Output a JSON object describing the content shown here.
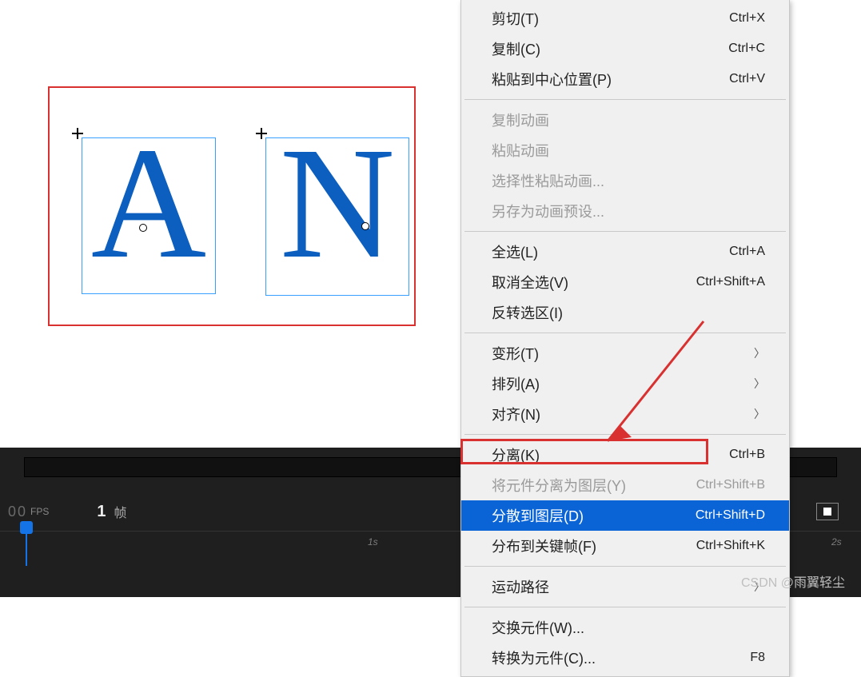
{
  "stage": {
    "letterA": "A",
    "letterN": "N"
  },
  "timeline": {
    "fps_value": "00",
    "fps_label": "FPS",
    "frame_number": "1",
    "frame_label": "帧",
    "tick_1s": "1s",
    "tick_2s": "2s"
  },
  "menu": {
    "cut": {
      "label": "剪切(T)",
      "shortcut": "Ctrl+X"
    },
    "copy": {
      "label": "复制(C)",
      "shortcut": "Ctrl+C"
    },
    "paste_center": {
      "label": "粘贴到中心位置(P)",
      "shortcut": "Ctrl+V"
    },
    "copy_motion": {
      "label": "复制动画"
    },
    "paste_motion": {
      "label": "粘贴动画"
    },
    "paste_motion_sp": {
      "label": "选择性粘贴动画..."
    },
    "save_preset": {
      "label": "另存为动画预设..."
    },
    "select_all": {
      "label": "全选(L)",
      "shortcut": "Ctrl+A"
    },
    "deselect": {
      "label": "取消全选(V)",
      "shortcut": "Ctrl+Shift+A"
    },
    "invert_sel": {
      "label": "反转选区(I)"
    },
    "transform": {
      "label": "变形(T)"
    },
    "arrange": {
      "label": "排列(A)"
    },
    "align": {
      "label": "对齐(N)"
    },
    "break_apart": {
      "label": "分离(K)",
      "shortcut": "Ctrl+B"
    },
    "break_to_layers": {
      "label": "将元件分离为图层(Y)",
      "shortcut": "Ctrl+Shift+B"
    },
    "distribute_layers": {
      "label": "分散到图层(D)",
      "shortcut": "Ctrl+Shift+D"
    },
    "distribute_kf": {
      "label": "分布到关键帧(F)",
      "shortcut": "Ctrl+Shift+K"
    },
    "motion_path": {
      "label": "运动路径"
    },
    "swap_symbol": {
      "label": "交换元件(W)..."
    },
    "convert_symbol": {
      "label": "转换为元件(C)...",
      "shortcut": "F8"
    }
  },
  "watermark": "CSDN @雨翼轻尘"
}
